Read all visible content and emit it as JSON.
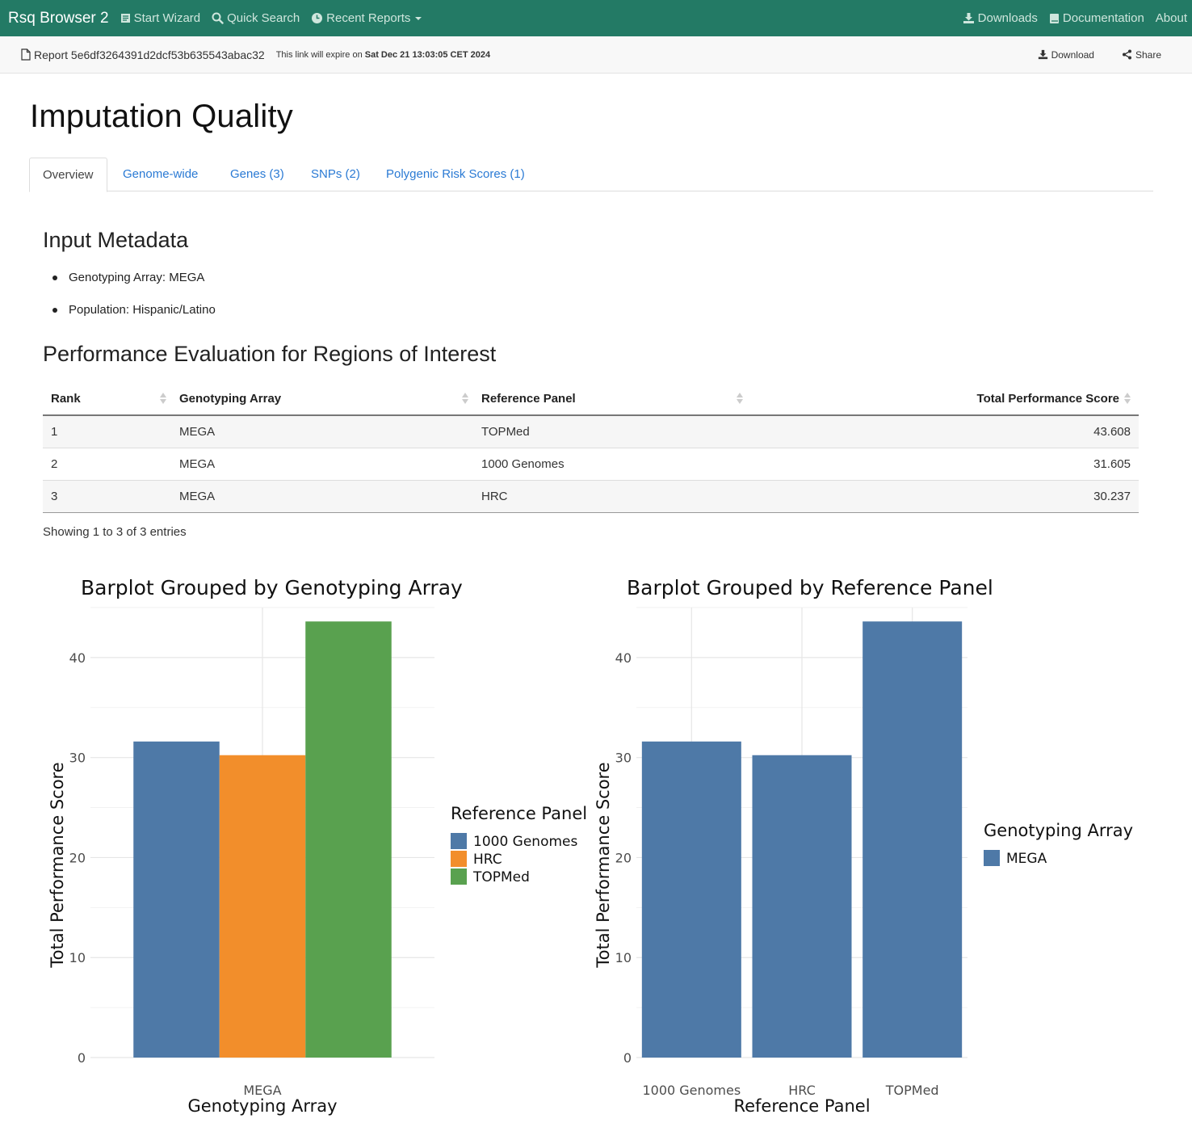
{
  "navbar": {
    "brand": "Rsq Browser 2",
    "left_items": [
      {
        "label": "Start Wizard",
        "icon": "book-icon"
      },
      {
        "label": "Quick Search",
        "icon": "search-icon"
      },
      {
        "label": "Recent Reports",
        "icon": "clock-icon"
      }
    ],
    "right_items": [
      {
        "label": "Downloads",
        "icon": "download-icon"
      },
      {
        "label": "Documentation",
        "icon": "book-icon"
      },
      {
        "label": "About"
      }
    ]
  },
  "report_bar": {
    "report_label": "Report 5e6df3264391d2dcf53b635543abac32",
    "expire_prefix": "This link will expire on",
    "expire_date": "Sat Dec 21 13:03:05 CET 2024",
    "download_label": "Download",
    "share_label": "Share"
  },
  "page": {
    "title": "Imputation Quality",
    "tabs": [
      "Overview",
      "Genome-wide",
      "Genes (3)",
      "SNPs (2)",
      "Polygenic Risk Scores (1)"
    ]
  },
  "metadata": {
    "heading": "Input Metadata",
    "items": [
      "Genotyping Array: MEGA",
      "Population: Hispanic/Latino"
    ]
  },
  "performance": {
    "heading": "Performance Evaluation for Regions of Interest",
    "columns": [
      "Rank",
      "Genotyping Array",
      "Reference Panel",
      "Total Performance Score"
    ],
    "rows": [
      [
        "1",
        "MEGA",
        "TOPMed",
        "43.608"
      ],
      [
        "2",
        "MEGA",
        "1000 Genomes",
        "31.605"
      ],
      [
        "3",
        "MEGA",
        "HRC",
        "30.237"
      ]
    ],
    "info": "Showing 1 to 3 of 3 entries"
  },
  "colors": {
    "navbar": "#237a65",
    "link": "#2a7ad4",
    "bar_blue": "#4e79a7",
    "bar_orange": "#f28e2b",
    "bar_green": "#59a14f"
  },
  "chart_data": [
    {
      "type": "bar",
      "title": "Barplot Grouped by Genotyping Array",
      "xlabel": "Genotyping Array",
      "ylabel": "Total Performance Score",
      "categories": [
        "MEGA"
      ],
      "series": [
        {
          "name": "1000 Genomes",
          "values": [
            31.605
          ],
          "color": "#4e79a7"
        },
        {
          "name": "HRC",
          "values": [
            30.237
          ],
          "color": "#f28e2b"
        },
        {
          "name": "TOPMed",
          "values": [
            43.608
          ],
          "color": "#59a14f"
        }
      ],
      "ylim": [
        0,
        45
      ],
      "yticks": [
        0,
        10,
        20,
        30,
        40
      ],
      "grid": true,
      "legend_title": "Reference Panel",
      "legend_position": "right"
    },
    {
      "type": "bar",
      "title": "Barplot Grouped by Reference Panel",
      "xlabel": "Reference Panel",
      "ylabel": "Total Performance Score",
      "categories": [
        "1000 Genomes",
        "HRC",
        "TOPMed"
      ],
      "series": [
        {
          "name": "MEGA",
          "values": [
            31.605,
            30.237,
            43.608
          ],
          "color": "#4e79a7"
        }
      ],
      "ylim": [
        0,
        45
      ],
      "yticks": [
        0,
        10,
        20,
        30,
        40
      ],
      "grid": true,
      "legend_title": "Genotyping Array",
      "legend_position": "right"
    }
  ]
}
